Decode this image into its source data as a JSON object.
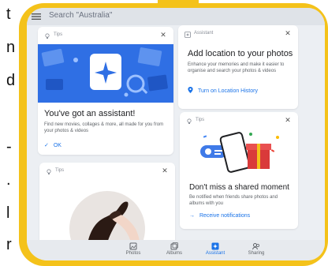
{
  "side_text": [
    "t",
    "n",
    "d",
    "-",
    ".",
    "l",
    "r"
  ],
  "search": {
    "placeholder": "Search \"Australia\""
  },
  "cards": {
    "assistant_intro": {
      "tag": "Tips",
      "title": "You've got an assistant!",
      "description": "Find new movies, collages & more, all made for you from your photos & videos",
      "action": "OK"
    },
    "location": {
      "tag": "Assistant",
      "title": "Add location to your photos",
      "description": "Enhance your memories and make it easier to organise and search your photos & videos",
      "action": "Turn on Location History"
    },
    "shared_moment": {
      "tag": "Tips",
      "title": "Don't miss a shared moment",
      "description": "Be notified when friends share photos and albums with you",
      "action": "Receive notifications"
    },
    "hands": {
      "tag": "Tips"
    }
  },
  "bottom_nav": [
    {
      "label": "Photos",
      "icon": "photos-icon"
    },
    {
      "label": "Albums",
      "icon": "albums-icon"
    },
    {
      "label": "Assistant",
      "icon": "assistant-icon"
    },
    {
      "label": "Sharing",
      "icon": "sharing-icon"
    }
  ],
  "colors": {
    "frame": "#f4c21a",
    "accent": "#1a73e8",
    "banner": "#2f6fe4"
  }
}
